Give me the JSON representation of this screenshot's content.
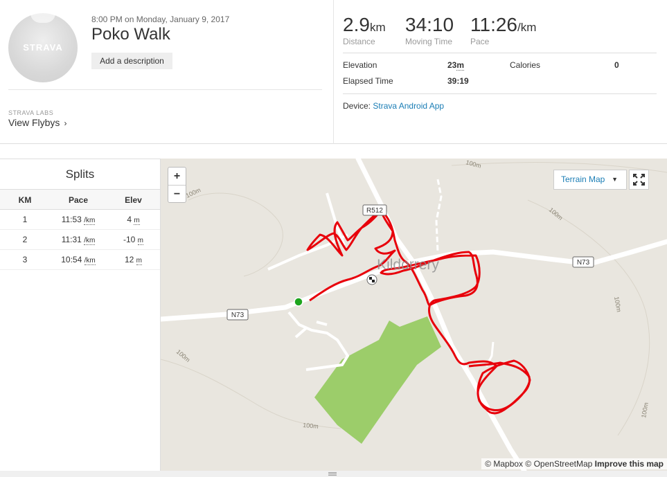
{
  "activity": {
    "date": "8:00 PM on Monday, January 9, 2017",
    "title": "Poko Walk",
    "add_description": "Add a description",
    "avatar_logo": "STRAVA"
  },
  "labs": {
    "label": "STRAVA LABS",
    "flybys": "View Flybys",
    "chevron": "›"
  },
  "stats": {
    "distance": {
      "value": "2.9",
      "unit": "km",
      "label": "Distance"
    },
    "moving_time": {
      "value": "34:10",
      "label": "Moving Time"
    },
    "pace": {
      "value": "11:26",
      "unit": "/km",
      "label": "Pace"
    }
  },
  "more_stats": {
    "elevation_label": "Elevation",
    "elevation_value": "23",
    "elevation_unit": "m",
    "calories_label": "Calories",
    "calories_value": "0",
    "elapsed_label": "Elapsed Time",
    "elapsed_value": "39:19"
  },
  "device": {
    "label": "Device:",
    "name": "Strava Android App"
  },
  "splits": {
    "title": "Splits",
    "headers": [
      "KM",
      "Pace",
      "Elev"
    ],
    "rows": [
      {
        "km": "1",
        "pace": "11:53",
        "pace_unit": "/km",
        "elev": "4",
        "elev_unit": "m"
      },
      {
        "km": "2",
        "pace": "11:31",
        "pace_unit": "/km",
        "elev": "-10",
        "elev_unit": "m"
      },
      {
        "km": "3",
        "pace": "10:54",
        "pace_unit": "/km",
        "elev": "12",
        "elev_unit": "m"
      }
    ]
  },
  "map": {
    "zoom_in": "+",
    "zoom_out": "−",
    "terrain_label": "Terrain Map",
    "town": "Kildorrery",
    "road_n73": "N73",
    "road_r512": "R512",
    "contour_label": "100m",
    "attribution_mapbox": "© Mapbox",
    "attribution_osm": "© OpenStreetMap",
    "attribution_improve": "Improve this map",
    "colors": {
      "route": "#e8000b",
      "park": "#9ccd6a",
      "start": "#1ea51e",
      "road": "#ffffff",
      "land": "#e9e6df"
    }
  }
}
